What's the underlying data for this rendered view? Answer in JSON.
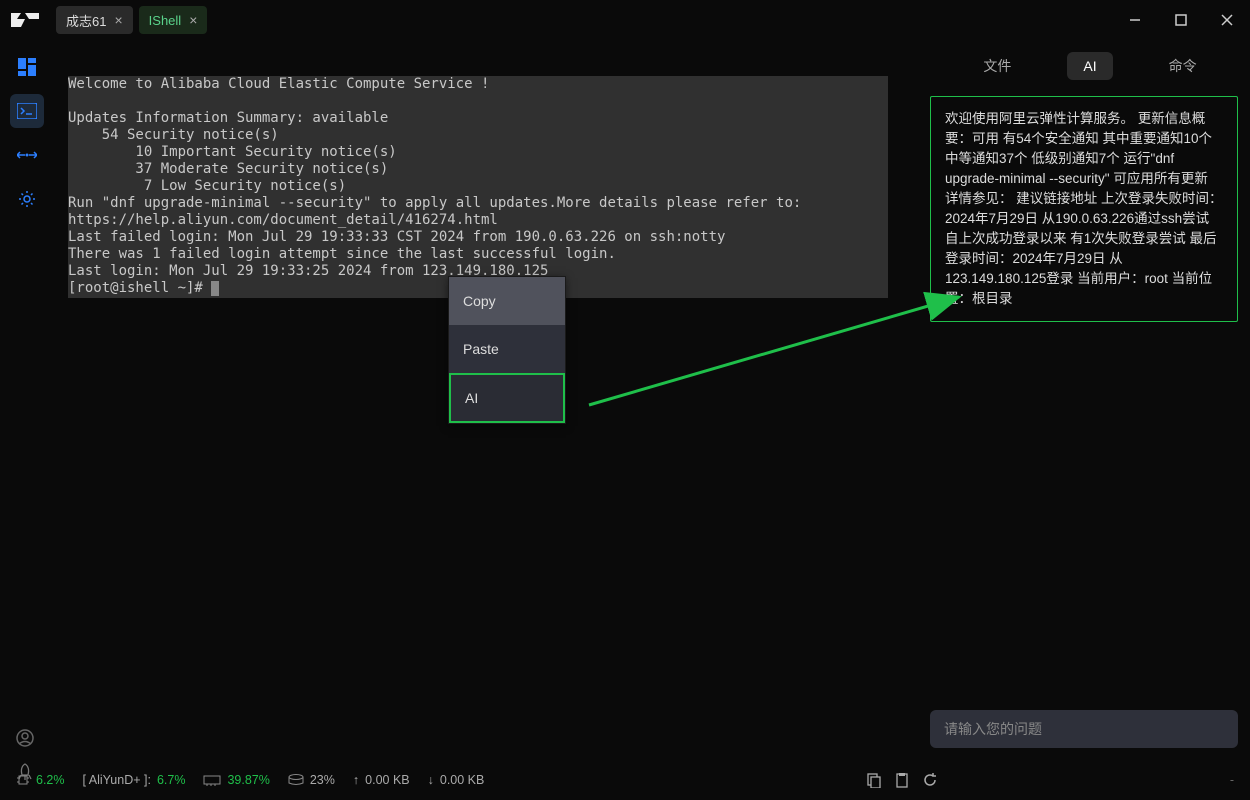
{
  "titlebar": {
    "tabs": [
      {
        "label": "成志61",
        "kind": "normal"
      },
      {
        "label": "IShell",
        "kind": "shell"
      }
    ]
  },
  "terminal": {
    "lines": [
      "Welcome to Alibaba Cloud Elastic Compute Service !",
      "",
      "Updates Information Summary: available",
      "    54 Security notice(s)",
      "        10 Important Security notice(s)",
      "        37 Moderate Security notice(s)",
      "         7 Low Security notice(s)",
      "Run \"dnf upgrade-minimal --security\" to apply all updates.More details please refer to:",
      "https://help.aliyun.com/document_detail/416274.html",
      "Last failed login: Mon Jul 29 19:33:33 CST 2024 from 190.0.63.226 on ssh:notty",
      "There was 1 failed login attempt since the last successful login.",
      "Last login: Mon Jul 29 19:33:25 2024 from 123.149.180.125",
      "[root@ishell ~]# "
    ]
  },
  "context_menu": {
    "copy": "Copy",
    "paste": "Paste",
    "ai": "AI"
  },
  "right_panel": {
    "tab_file": "文件",
    "tab_ai": "AI",
    "tab_cmd": "命令",
    "ai_response": "欢迎使用阿里云弹性计算服务。 更新信息概要：可用 有54个安全通知 其中重要通知10个 中等通知37个 低级别通知7个 运行\"dnf upgrade-minimal --security\" 可应用所有更新 详情参见： 建议链接地址 上次登录失败时间：2024年7月29日 从190.0.63.226通过ssh尝试 自上次成功登录以来 有1次失败登录尝试 最后登录时间：2024年7月29日 从123.149.180.125登录 当前用户：root 当前位置：根目录",
    "input_placeholder": "请输入您的问题"
  },
  "statusbar": {
    "cpu": "6.2%",
    "aliyun_label": "[ AliYunD+ ]:",
    "aliyun": "6.7%",
    "mem": "39.87%",
    "disk": "23%",
    "up": "0.00 KB",
    "down": "0.00 KB",
    "right_dash": "-"
  },
  "sidebar_icons": [
    "grid",
    "terminal",
    "transfer",
    "gear"
  ],
  "statusbar_icons": [
    "copy",
    "paste",
    "refresh"
  ]
}
